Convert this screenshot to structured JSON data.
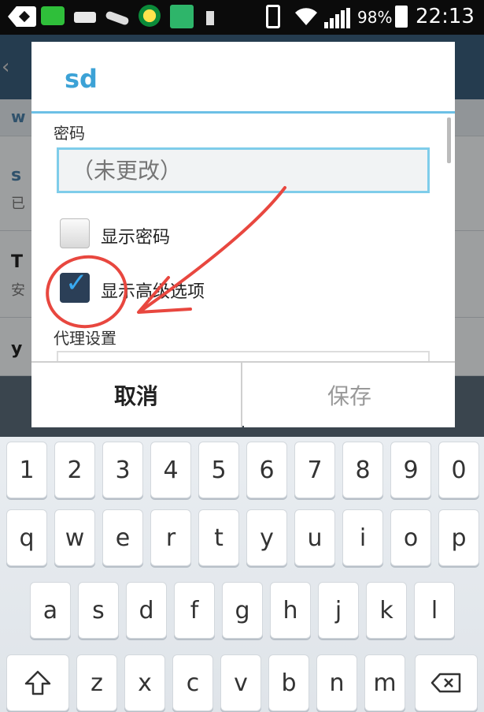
{
  "status_bar": {
    "battery_percent": "98%",
    "time": "22:13"
  },
  "background_list": [
    {
      "title": "w",
      "subtitle": ""
    },
    {
      "title": "s",
      "subtitle": "已"
    },
    {
      "title": "T",
      "subtitle": "安"
    },
    {
      "title": "y",
      "subtitle": ""
    }
  ],
  "dialog": {
    "title": "sd",
    "password_label": "密码",
    "password_placeholder": "（未更改）",
    "show_password_label": "显示密码",
    "show_password_checked": false,
    "advanced_options_label": "显示高级选项",
    "advanced_options_checked": true,
    "proxy_label": "代理设置",
    "cancel_button": "取消",
    "save_button": "保存"
  },
  "keyboard": {
    "row1": [
      "1",
      "2",
      "3",
      "4",
      "5",
      "6",
      "7",
      "8",
      "9",
      "0"
    ],
    "row2": [
      "q",
      "w",
      "e",
      "r",
      "t",
      "y",
      "u",
      "i",
      "o",
      "p"
    ],
    "row3": [
      "a",
      "s",
      "d",
      "f",
      "g",
      "h",
      "j",
      "k",
      "l"
    ],
    "row4": [
      "z",
      "x",
      "c",
      "v",
      "b",
      "n",
      "m"
    ],
    "shift_icon": "shift-icon",
    "backspace_icon": "backspace-icon"
  },
  "colors": {
    "accent": "#3ca2d6",
    "annotation": "#e8473f"
  }
}
